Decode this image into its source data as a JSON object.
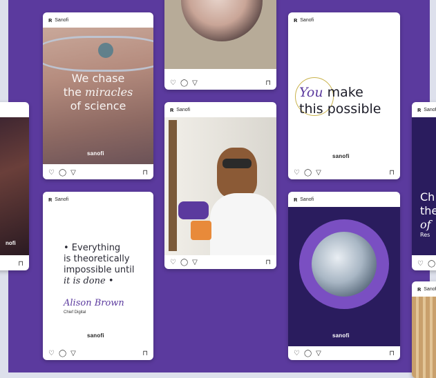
{
  "brand": {
    "label": "Sanofi",
    "wordmark": "sanofi"
  },
  "colors": {
    "background": "#5b3a9e",
    "accent": "#5b3a9e",
    "card": "#ffffff"
  },
  "icons": {
    "like": "heart-icon",
    "comment": "comment-icon",
    "share": "share-icon",
    "save": "bookmark-icon"
  },
  "glyphs": {
    "like": "♡",
    "comment": "◯",
    "share": "▽",
    "save": "⊓"
  },
  "cards": {
    "science": {
      "line1": "We chase",
      "line2_pre": "the ",
      "line2_it": "miracles",
      "line3": "of science"
    },
    "possible": {
      "you": "You",
      "make": "make",
      "line2": "this possible"
    },
    "quote": {
      "line1": "• Everything",
      "line2": "is theoretically",
      "line3": "impossible until",
      "line4": "it is done •",
      "author": "Alison Brown",
      "role": "Chief Digital"
    },
    "partial": {
      "line1": "Ch",
      "line2": "the",
      "line3": "of",
      "line4": "Res"
    },
    "left_partial": {
      "caption": "nofi"
    }
  }
}
